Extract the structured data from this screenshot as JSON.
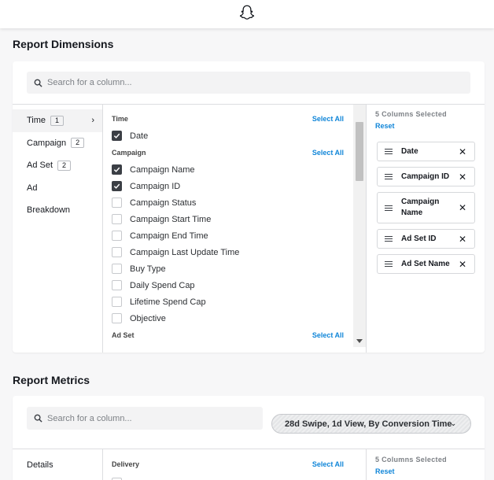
{
  "header": {
    "logo_icon": "snapchat-ghost-icon"
  },
  "dimensions": {
    "title": "Report Dimensions",
    "search_placeholder": "Search for a column...",
    "nav": [
      {
        "label": "Time",
        "count": "1",
        "active": true
      },
      {
        "label": "Campaign",
        "count": "2"
      },
      {
        "label": "Ad Set",
        "count": "2"
      },
      {
        "label": "Ad"
      },
      {
        "label": "Breakdown"
      }
    ],
    "groups": {
      "time": {
        "label": "Time",
        "select_all": "Select All"
      },
      "campaign": {
        "label": "Campaign",
        "select_all": "Select All"
      },
      "adset": {
        "label": "Ad Set",
        "select_all": "Select All"
      }
    },
    "time_options": [
      {
        "label": "Date",
        "checked": true
      }
    ],
    "campaign_options": [
      {
        "label": "Campaign Name",
        "checked": true
      },
      {
        "label": "Campaign ID",
        "checked": true
      },
      {
        "label": "Campaign Status",
        "checked": false
      },
      {
        "label": "Campaign Start Time",
        "checked": false
      },
      {
        "label": "Campaign End Time",
        "checked": false
      },
      {
        "label": "Campaign Last Update Time",
        "checked": false
      },
      {
        "label": "Buy Type",
        "checked": false
      },
      {
        "label": "Daily Spend Cap",
        "checked": false
      },
      {
        "label": "Lifetime Spend Cap",
        "checked": false
      },
      {
        "label": "Objective",
        "checked": false
      }
    ],
    "selected_header": "5 Columns Selected",
    "reset": "Reset",
    "selected": [
      {
        "label": "Date"
      },
      {
        "label": "Campaign ID"
      },
      {
        "label": "Campaign Name"
      },
      {
        "label": "Ad Set ID"
      },
      {
        "label": "Ad Set Name"
      }
    ],
    "remove_glyph": "✕"
  },
  "metrics": {
    "title": "Report Metrics",
    "search_placeholder": "Search for a column...",
    "attribution": "28d Swipe, 1d View, By Conversion Time",
    "nav": [
      {
        "label": "Details"
      }
    ],
    "group": {
      "label": "Delivery",
      "select_all": "Select All"
    },
    "selected_header": "5 Columns Selected",
    "reset": "Reset"
  },
  "colors": {
    "accent": "#0f85d8",
    "checkbox_on": "#3b3f45",
    "border": "#dcdde0"
  }
}
